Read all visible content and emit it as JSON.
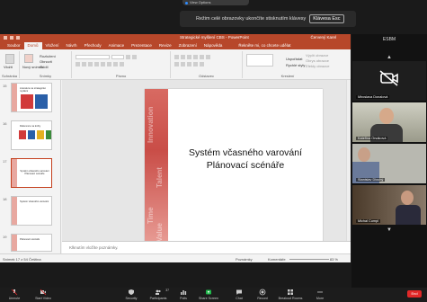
{
  "zoom_pill": {
    "label": "View Options"
  },
  "fullscreen_banner": {
    "text": "Režim celé obrazovky ukončíte stisknutím klávesy",
    "key": "Klávesa Esc"
  },
  "ppt": {
    "title": "Strategické myšlení CBS - PowerPoint",
    "user": "Červený Karel",
    "tabs": [
      "Soubor",
      "Domů",
      "Vložení",
      "Návrh",
      "Přechody",
      "Animace",
      "Prezentace",
      "Revize",
      "Zobrazení",
      "Nápověda"
    ],
    "active_tab": "Domů",
    "tell_me": "Řekněte mi, co chcete udělat",
    "ribbon": {
      "paste": "Vložit",
      "clipboard": "Schránka",
      "new_slide": "Nový snímek",
      "layout": "Rozložení",
      "reset": "Obnovit",
      "section": "Oddíl",
      "slides": "Snímky",
      "font": "Písmo",
      "paragraph": "Odstavec",
      "drawing": "Kreslení",
      "arrange": "Uspořádat",
      "quick_styles": "Rychlé styly",
      "shape_fill": "Výplň obrazce",
      "shape_outline": "Obrys obrazce",
      "shape_effects": "Efekty obrazce"
    },
    "thumbs": [
      {
        "num": "15",
        "text": "Literatura na strategické myšlení"
      },
      {
        "num": "16",
        "text": "Reference na knihy"
      },
      {
        "num": "17",
        "text": "Systém včasného varování Plánovací scénáře",
        "selected": true
      },
      {
        "num": "18",
        "text": "Systém včasného varování"
      },
      {
        "num": "19",
        "text": "Plánovací scénáře"
      }
    ],
    "slide": {
      "title_line1": "Systém včasného varování",
      "title_line2": "Plánovací scénáře",
      "band_words": [
        "Innovation",
        "Talent",
        "Time",
        "Value"
      ]
    },
    "notes_placeholder": "Klknutím vložíte poznámky.",
    "status": {
      "slide": "Snímek 17 z 54",
      "lang": "Čeština",
      "notes": "Poznámky",
      "comments": "Komentáře",
      "zoom": "83 %"
    }
  },
  "panel": {
    "title": "ESBM",
    "participants": [
      {
        "name": "Miroslava Donalová",
        "video": false
      },
      {
        "name": "Kateřina Orsáková",
        "video": true
      },
      {
        "name": "Stanislav Dlouhý",
        "video": true
      },
      {
        "name": "Michal Cumpl",
        "video": true
      }
    ]
  },
  "toolbar": {
    "items": [
      "Unmute",
      "Start Video",
      "Security",
      "Participants",
      "Polls",
      "Share Screen",
      "Chat",
      "Record",
      "Breakout Rooms",
      "More"
    ],
    "participants_count": "37",
    "end": "End"
  },
  "colors": {
    "ppt_red": "#b7472a",
    "end_red": "#e02828",
    "panel_bg": "#121212"
  }
}
